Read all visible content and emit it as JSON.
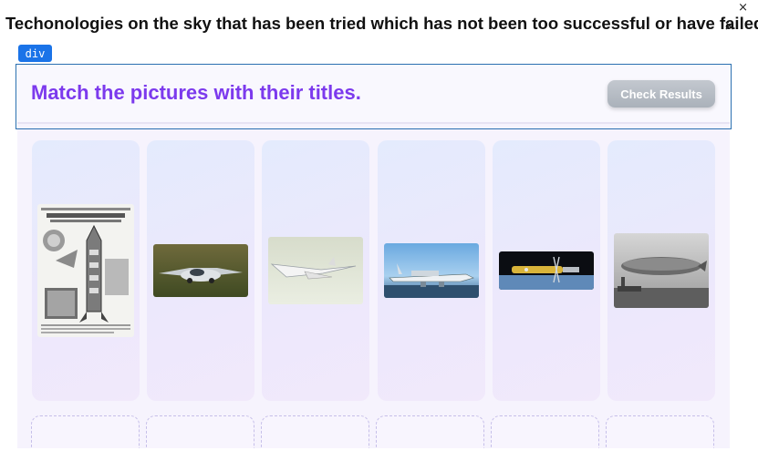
{
  "page_title": "Techonologies on the sky that has been tried which has not been too successful or have failed",
  "close_symbol": "×",
  "inspector_tag": "div",
  "header": {
    "instruction": "Match the pictures with their titles.",
    "check_button": "Check Results"
  },
  "colors": {
    "accent_purple": "#7c3aed",
    "inspector_blue": "#1a73e8",
    "button_disabled_gray": "#b4bac2"
  },
  "cards": [
    {
      "image": "radio-rocket-magazine-page"
    },
    {
      "image": "flying-car-prototype"
    },
    {
      "image": "supersonic-airliner"
    },
    {
      "image": "ekranoplan-ground-effect-vehicle"
    },
    {
      "image": "nuclear-rocket-engine-concept"
    },
    {
      "image": "zeppelin-airship"
    }
  ],
  "title_slots": [
    "",
    "",
    "",
    "",
    "",
    ""
  ]
}
